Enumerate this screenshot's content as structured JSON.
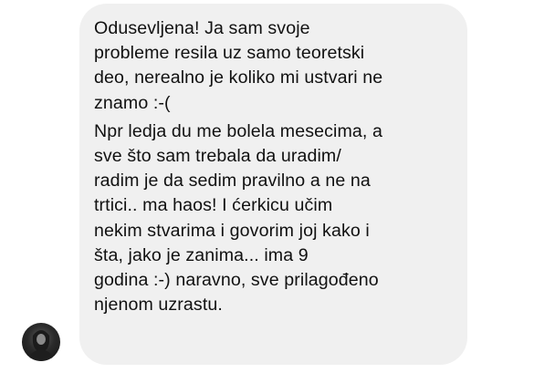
{
  "message": {
    "paragraphs": [
      {
        "lines": [
          "Odusevljena! Ja sam svoje",
          "probleme resila uz samo teoretski",
          "deo, nerealno je koliko mi ustvari ne",
          "znamo :-("
        ]
      },
      {
        "lines": [
          "Npr ledja du me bolela mesecima, a",
          "sve što sam trebala da uradim/",
          "radim je da sedim pravilno a ne na",
          "trtici.. ma haos!   I ćerkicu učim",
          "nekim stvarima i govorim joj kako i",
          "šta, jako je zanima... ima 9",
          "godina :-) naravno, sve prilagođeno",
          "njenom uzrastu."
        ]
      }
    ],
    "bubble_color": "#f0f0f0",
    "text_color": "#111111"
  },
  "sender": {
    "avatar_icon": "user-avatar-icon"
  }
}
